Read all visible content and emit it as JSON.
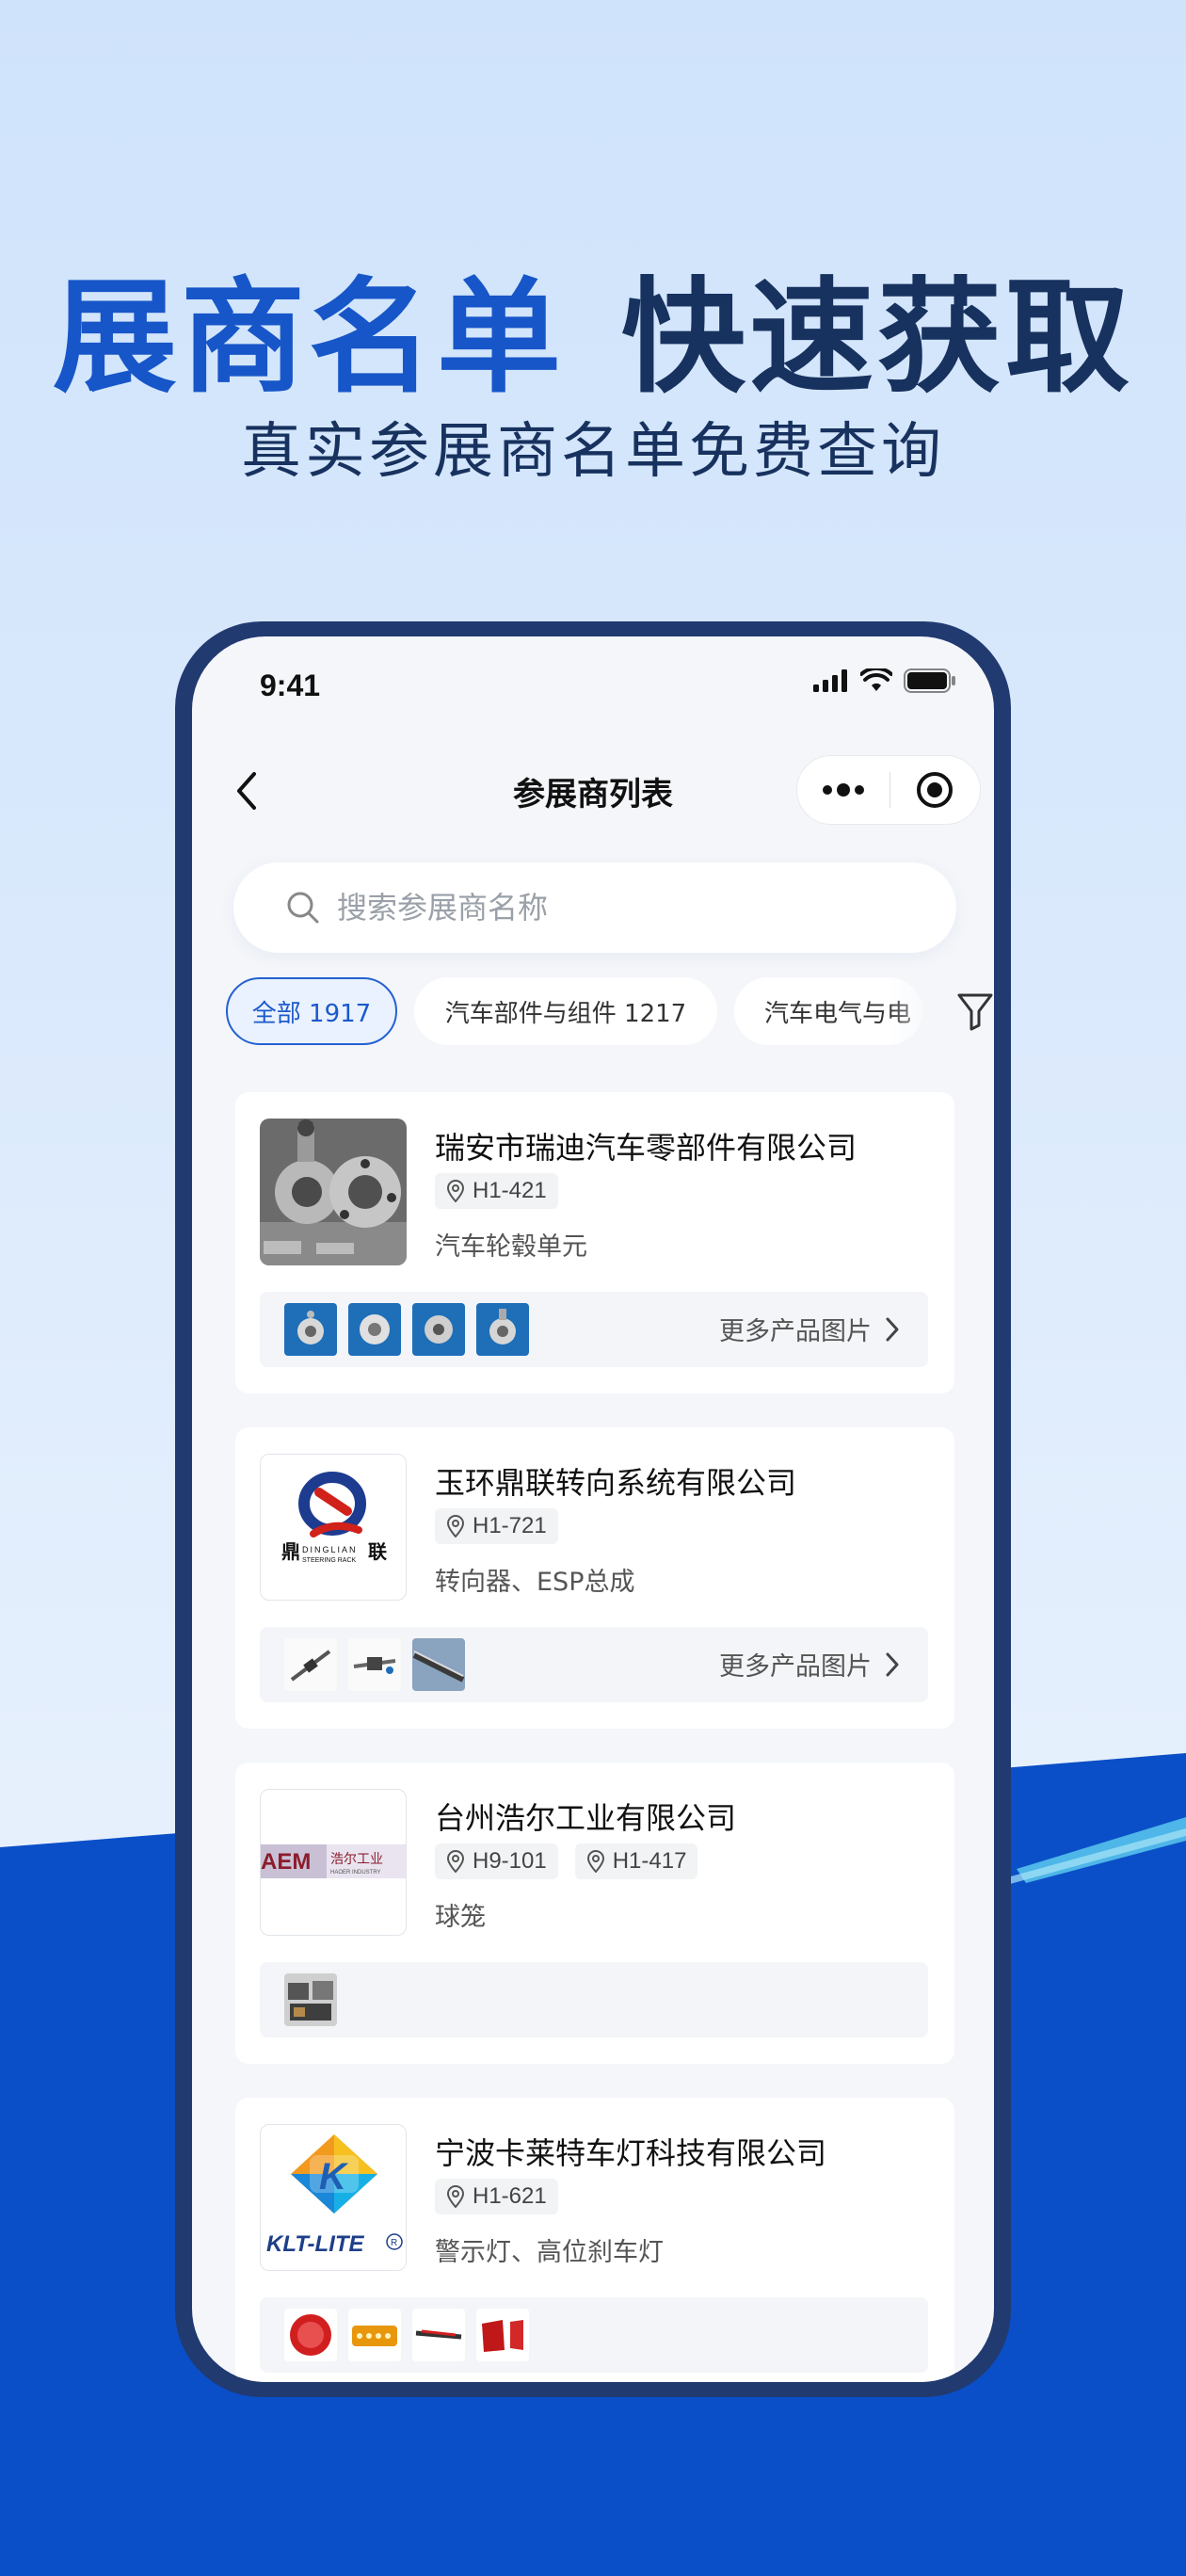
{
  "promo": {
    "headline_part1": "展商名单",
    "headline_part2": "快速获取",
    "subheadline": "真实参展商名单免费查询"
  },
  "status_bar": {
    "time": "9:41"
  },
  "navbar": {
    "title": "参展商列表",
    "back_icon": "chevron-left-icon",
    "more_icon": "more-dots-icon",
    "close_icon": "target-icon"
  },
  "search": {
    "placeholder": "搜索参展商名称",
    "value": ""
  },
  "filters": {
    "chips": [
      {
        "label": "全部 1917",
        "active": true
      },
      {
        "label": "汽车部件与组件 1217",
        "active": false
      },
      {
        "label": "汽车电气与电",
        "active": false
      }
    ],
    "filter_icon": "funnel-icon"
  },
  "exhibitors": [
    {
      "name": "瑞安市瑞迪汽车零部件有限公司",
      "booths": [
        "H1-421"
      ],
      "products": "汽车轮毂单元",
      "more_label": "更多产品图片",
      "thumbs": 4
    },
    {
      "name": "玉环鼎联转向系统有限公司",
      "booths": [
        "H1-721"
      ],
      "products": "转向器、ESP总成",
      "more_label": "更多产品图片",
      "thumbs": 3,
      "logo_text": {
        "main": "鼎",
        "sub1": "DINGLIAN",
        "sub2": "STEERING RACK",
        "side": "联"
      }
    },
    {
      "name": "台州浩尔工业有限公司",
      "booths": [
        "H9-101",
        "H1-417"
      ],
      "products": "球笼",
      "thumbs": 1,
      "logo_text": {
        "mark": "AEM",
        "cn": "浩尔工业",
        "en": "HAOER INDUSTRY"
      }
    },
    {
      "name": "宁波卡莱特车灯科技有限公司",
      "booths": [
        "H1-621"
      ],
      "products": "警示灯、高位刹车灯",
      "thumbs": 4,
      "logo_text": {
        "letter": "K",
        "brand": "KLT-LITE",
        "reg": "R"
      }
    }
  ],
  "colors": {
    "accent": "#1756c8",
    "dark": "#18325f",
    "phone_frame": "#213a70",
    "wave": "#0a4fc7"
  }
}
